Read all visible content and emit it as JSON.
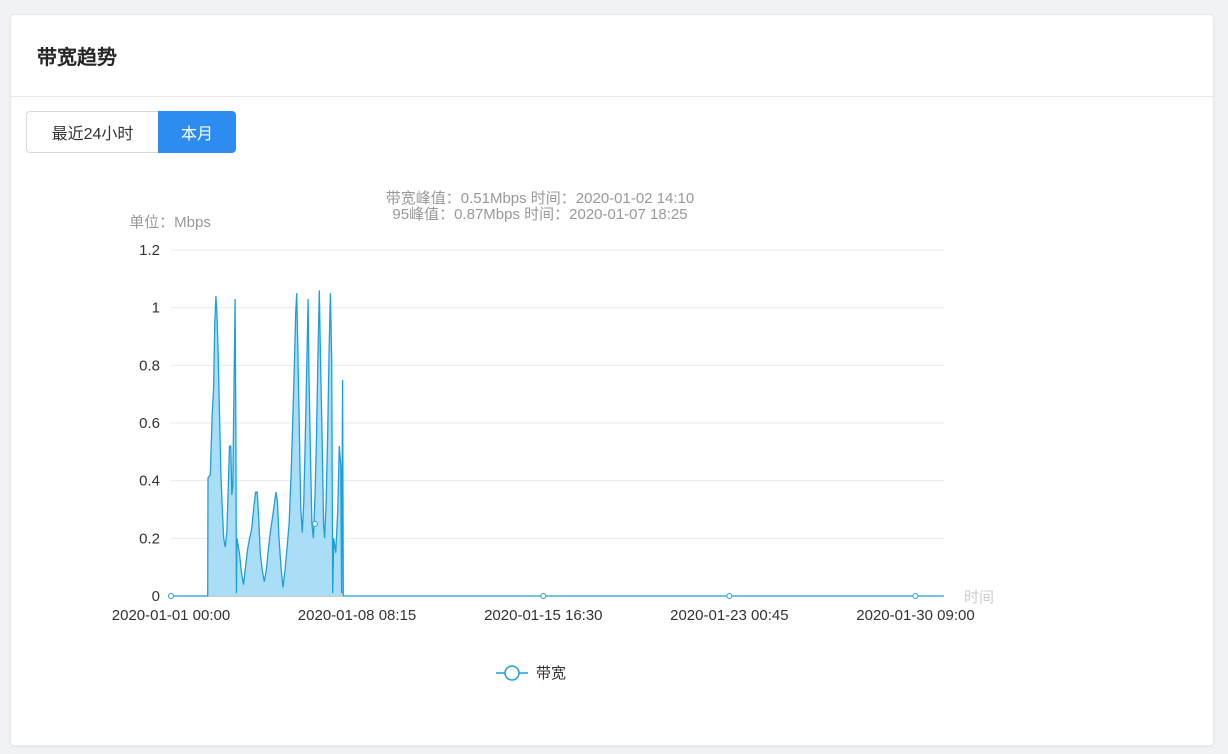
{
  "panel": {
    "title": "带宽趋势"
  },
  "tabs": [
    {
      "label": "最近24小时",
      "active": false
    },
    {
      "label": "本月",
      "active": true
    }
  ],
  "colors": {
    "accent": "#2d8cf0",
    "line": "#1f9fd8",
    "fill": "#a5dcf7"
  },
  "chart_data": {
    "type": "area",
    "summary_line1": "带宽峰值：0.51Mbps 时间：2020-01-02 14:10",
    "summary_line2": "95峰值：0.87Mbps 时间：2020-01-07 18:25",
    "ylabel": "单位：Mbps",
    "xlabel": "时间",
    "ylim": [
      0,
      1.2
    ],
    "yticks": [
      "1.2",
      "1",
      "0.8",
      "0.6",
      "0.4",
      "0.2",
      "0"
    ],
    "xlim": [
      0,
      30.5
    ],
    "xticks": [
      {
        "x": 0,
        "label": "2020-01-01 00:00"
      },
      {
        "x": 7.34,
        "label": "2020-01-08 08:15"
      },
      {
        "x": 14.69,
        "label": "2020-01-15 16:30"
      },
      {
        "x": 22.03,
        "label": "2020-01-23 00:45"
      },
      {
        "x": 29.375,
        "label": "2020-01-30 09:00"
      }
    ],
    "grid": true,
    "legend_position": "bottom",
    "series": [
      {
        "name": "带宽",
        "points": [
          [
            0,
            0
          ],
          [
            1.45,
            0
          ],
          [
            1.46,
            0.41
          ],
          [
            1.55,
            0.42
          ],
          [
            1.62,
            0.62
          ],
          [
            1.68,
            0.72
          ],
          [
            1.73,
            0.95
          ],
          [
            1.77,
            1.04
          ],
          [
            1.81,
            0.98
          ],
          [
            1.86,
            0.85
          ],
          [
            1.92,
            0.6
          ],
          [
            1.97,
            0.42
          ],
          [
            2.02,
            0.31
          ],
          [
            2.08,
            0.2
          ],
          [
            2.14,
            0.17
          ],
          [
            2.2,
            0.22
          ],
          [
            2.26,
            0.38
          ],
          [
            2.31,
            0.52
          ],
          [
            2.36,
            0.52
          ],
          [
            2.4,
            0.35
          ],
          [
            2.44,
            0.38
          ],
          [
            2.49,
            0.75
          ],
          [
            2.53,
            1.03
          ],
          [
            2.56,
            0.55
          ],
          [
            2.58,
            0.01
          ],
          [
            2.6,
            0.2
          ],
          [
            2.7,
            0.15
          ],
          [
            2.78,
            0.08
          ],
          [
            2.86,
            0.04
          ],
          [
            2.94,
            0.1
          ],
          [
            3.02,
            0.16
          ],
          [
            3.1,
            0.2
          ],
          [
            3.18,
            0.23
          ],
          [
            3.26,
            0.3
          ],
          [
            3.34,
            0.36
          ],
          [
            3.4,
            0.36
          ],
          [
            3.46,
            0.27
          ],
          [
            3.52,
            0.15
          ],
          [
            3.6,
            0.09
          ],
          [
            3.68,
            0.05
          ],
          [
            3.76,
            0.09
          ],
          [
            3.84,
            0.16
          ],
          [
            3.92,
            0.22
          ],
          [
            4.0,
            0.27
          ],
          [
            4.08,
            0.32
          ],
          [
            4.14,
            0.36
          ],
          [
            4.2,
            0.33
          ],
          [
            4.26,
            0.2
          ],
          [
            4.34,
            0.1
          ],
          [
            4.42,
            0.03
          ],
          [
            4.5,
            0.09
          ],
          [
            4.58,
            0.17
          ],
          [
            4.66,
            0.25
          ],
          [
            4.74,
            0.42
          ],
          [
            4.8,
            0.6
          ],
          [
            4.86,
            0.78
          ],
          [
            4.92,
            0.98
          ],
          [
            4.96,
            1.05
          ],
          [
            5.0,
            0.88
          ],
          [
            5.06,
            0.6
          ],
          [
            5.12,
            0.3
          ],
          [
            5.18,
            0.22
          ],
          [
            5.24,
            0.33
          ],
          [
            5.3,
            0.55
          ],
          [
            5.36,
            0.8
          ],
          [
            5.41,
            1.03
          ],
          [
            5.44,
            0.78
          ],
          [
            5.5,
            0.5
          ],
          [
            5.56,
            0.25
          ],
          [
            5.62,
            0.2
          ],
          [
            5.68,
            0.35
          ],
          [
            5.74,
            0.55
          ],
          [
            5.8,
            0.84
          ],
          [
            5.85,
            1.06
          ],
          [
            5.9,
            0.82
          ],
          [
            5.96,
            0.55
          ],
          [
            6.02,
            0.25
          ],
          [
            6.06,
            0.2
          ],
          [
            6.12,
            0.32
          ],
          [
            6.18,
            0.55
          ],
          [
            6.24,
            0.85
          ],
          [
            6.29,
            1.05
          ],
          [
            6.34,
            0.82
          ],
          [
            6.38,
            0.01
          ],
          [
            6.42,
            0.2
          ],
          [
            6.5,
            0.15
          ],
          [
            6.58,
            0.3
          ],
          [
            6.64,
            0.52
          ],
          [
            6.7,
            0.45
          ],
          [
            6.73,
            0.01
          ],
          [
            6.77,
            0.75
          ],
          [
            6.8,
            0
          ],
          [
            30.5,
            0
          ]
        ]
      }
    ]
  }
}
